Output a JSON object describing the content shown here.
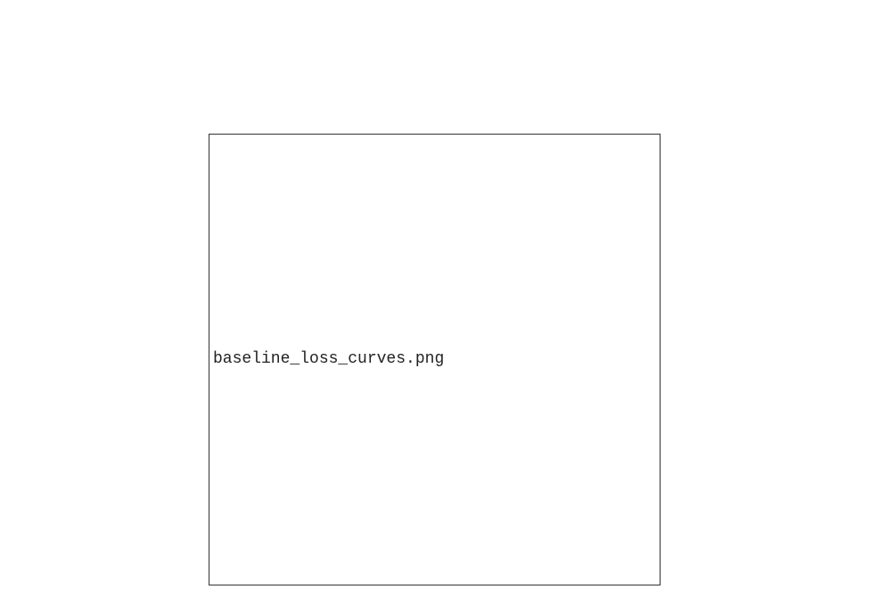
{
  "figure": {
    "placeholder_filename": "baseline_loss_curves.png"
  },
  "colors": {
    "background": "#ffffff",
    "border": "#333333",
    "text": "#222222"
  }
}
